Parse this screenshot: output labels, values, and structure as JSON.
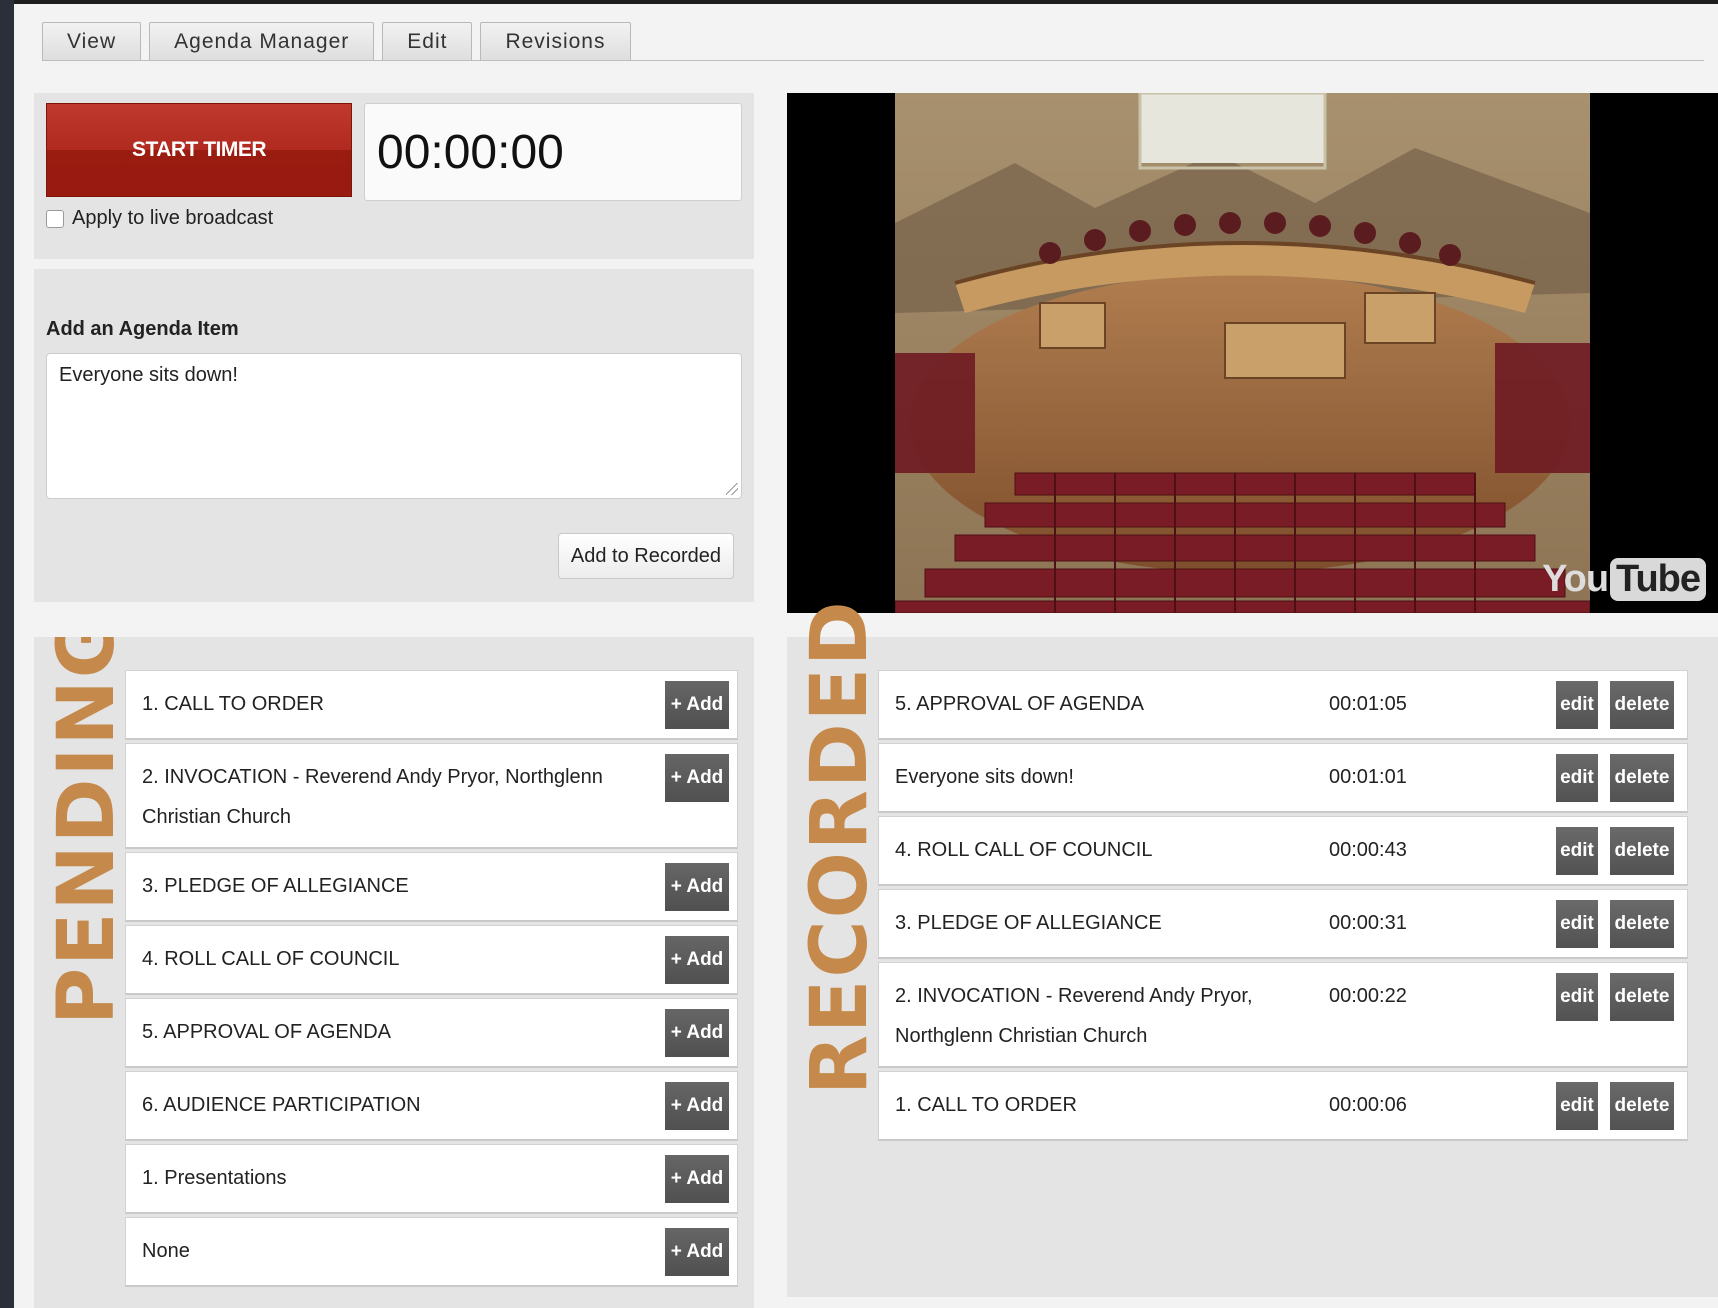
{
  "tabs": [
    {
      "label": "View"
    },
    {
      "label": "Agenda Manager"
    },
    {
      "label": "Edit"
    },
    {
      "label": "Revisions"
    }
  ],
  "timer": {
    "start_label": "START TIMER",
    "display": "00:00:00",
    "broadcast_label": "Apply to live broadcast",
    "broadcast_checked": false
  },
  "add_item": {
    "label": "Add an Agenda Item",
    "text": "Everyone sits down!",
    "button_label": "Add to Recorded"
  },
  "video": {
    "logo_you": "You",
    "logo_tube": "Tube"
  },
  "pending": {
    "heading": "PENDING",
    "add_label": "+ Add",
    "items": [
      {
        "label": "1. CALL TO ORDER"
      },
      {
        "label": "2. INVOCATION - Reverend Andy Pryor, Northglenn Christian Church"
      },
      {
        "label": "3. PLEDGE OF ALLEGIANCE"
      },
      {
        "label": "4. ROLL CALL OF COUNCIL"
      },
      {
        "label": "5. APPROVAL OF AGENDA"
      },
      {
        "label": "6. AUDIENCE PARTICIPATION"
      },
      {
        "label": "1. Presentations"
      },
      {
        "label": "None"
      }
    ]
  },
  "recorded": {
    "heading": "RECORDED",
    "edit_label": "edit",
    "delete_label": "delete",
    "items": [
      {
        "label": "5. APPROVAL OF AGENDA",
        "time": "00:01:05"
      },
      {
        "label": "Everyone sits down!",
        "time": "00:01:01"
      },
      {
        "label": "4. ROLL CALL OF COUNCIL",
        "time": "00:00:43"
      },
      {
        "label": "3. PLEDGE OF ALLEGIANCE",
        "time": "00:00:31"
      },
      {
        "label": "2. INVOCATION - Reverend Andy Pryor, Northglenn Christian Church",
        "time": "00:00:22"
      },
      {
        "label": "1. CALL TO ORDER",
        "time": "00:00:06"
      }
    ]
  },
  "colors": {
    "start_button": "#a8241a",
    "heading_accent": "#c58a4b",
    "action_button": "#595959"
  }
}
